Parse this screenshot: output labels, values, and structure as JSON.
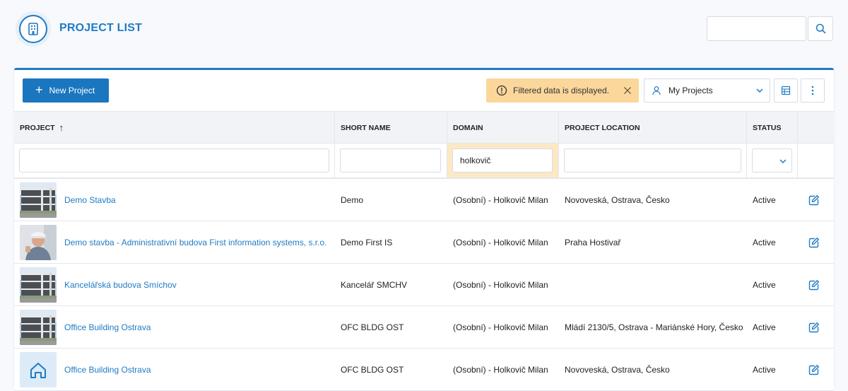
{
  "header": {
    "title": "PROJECT LIST",
    "search_placeholder": "",
    "logo_icon": "building-icon",
    "search_icon": "search-icon"
  },
  "toolbar": {
    "new_project_label": "New Project",
    "filter_notice": "Filtered data is displayed.",
    "view_select_value": "My Projects",
    "accent_color": "#1a76bf",
    "notice_color": "#fbd79c"
  },
  "columns": {
    "project": "PROJECT",
    "short_name": "SHORT NAME",
    "domain": "DOMAIN",
    "location": "PROJECT LOCATION",
    "status": "STATUS",
    "sort_indicator": "↑"
  },
  "filters": {
    "project": "",
    "short_name": "",
    "domain": "holkovič",
    "location": "",
    "status": ""
  },
  "rows": [
    {
      "thumb": "building-photo",
      "project": "Demo Stavba",
      "short_name": "Demo",
      "domain": "(Osobní) - Holkovič Milan",
      "location": "Novoveská, Ostrava, Česko",
      "status": "Active"
    },
    {
      "thumb": "person-photo",
      "project": "Demo stavba - Administrativní budova First information systems, s.r.o.",
      "short_name": "Demo First IS",
      "domain": "(Osobní) - Holkovič Milan",
      "location": "Praha Hostivař",
      "status": "Active"
    },
    {
      "thumb": "building-photo",
      "project": "Kancelářská budova Smíchov",
      "short_name": "Kancelář SMCHV",
      "domain": "(Osobní) - Holkovič Milan",
      "location": "",
      "status": "Active"
    },
    {
      "thumb": "building-photo",
      "project": "Office Building Ostrava",
      "short_name": "OFC BLDG OST",
      "domain": "(Osobní) - Holkovič Milan",
      "location": "Mládí 2130/5, Ostrava - Mariánské Hory, Česko",
      "status": "Active"
    },
    {
      "thumb": "home-icon",
      "project": "Office Building Ostrava",
      "short_name": "OFC BLDG OST",
      "domain": "(Osobní) - Holkovič Milan",
      "location": "Novoveská, Ostrava, Česko",
      "status": "Active"
    }
  ]
}
